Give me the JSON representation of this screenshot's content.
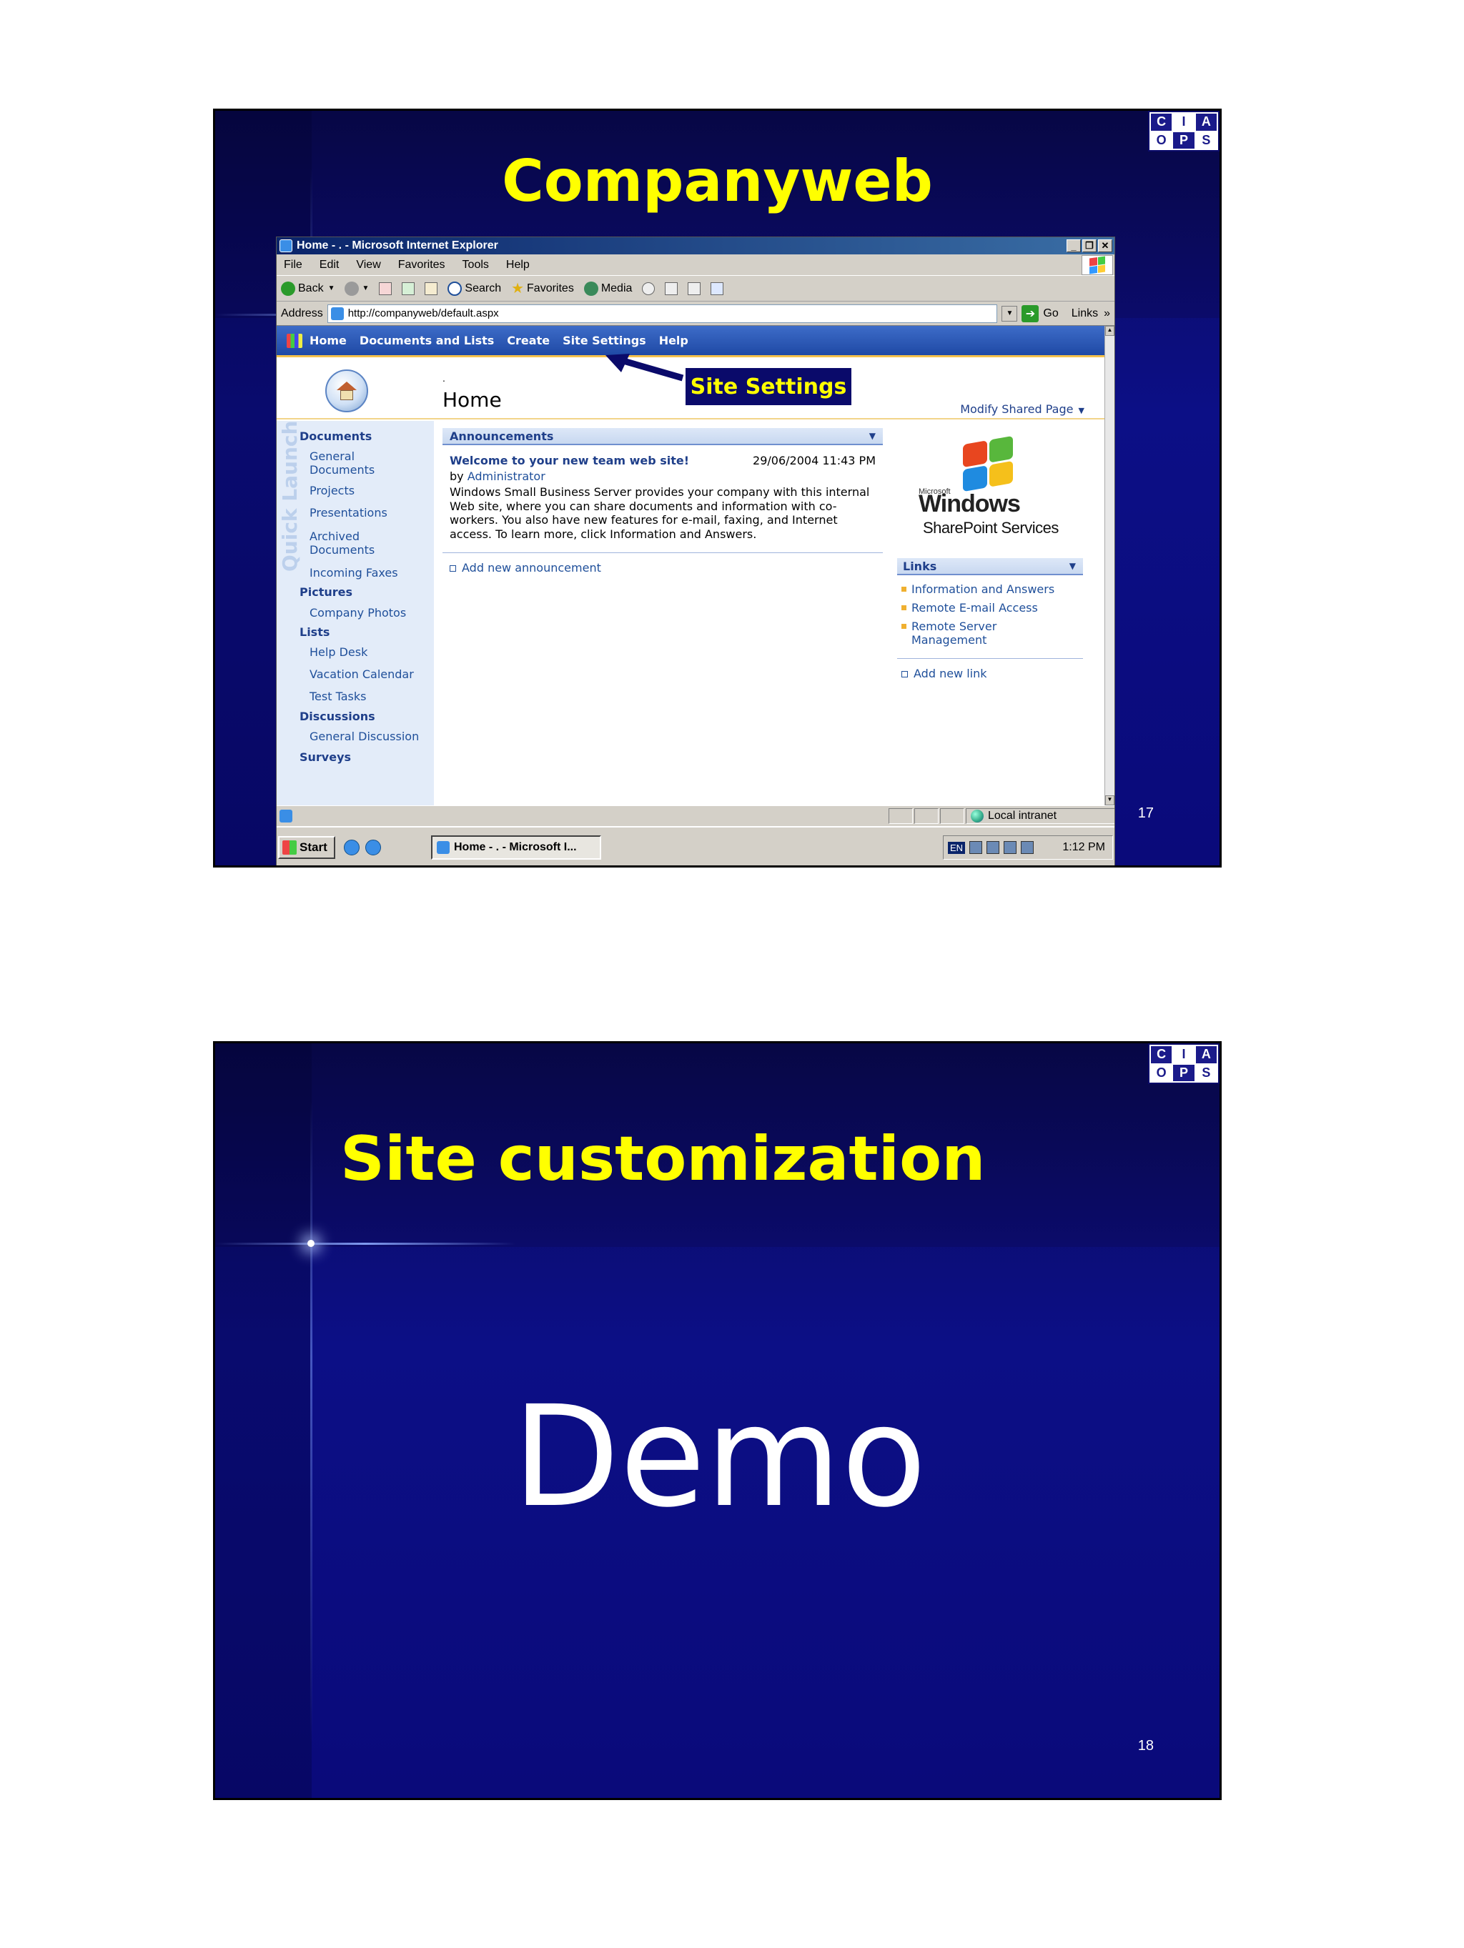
{
  "slide1": {
    "title": "Companyweb",
    "number": "17",
    "logo": [
      "C",
      "I",
      "A",
      "O",
      "P",
      "S"
    ],
    "browser": {
      "window_title": "Home - . - Microsoft Internet Explorer",
      "menu": [
        "File",
        "Edit",
        "View",
        "Favorites",
        "Tools",
        "Help"
      ],
      "toolbar": {
        "back": "Back",
        "search": "Search",
        "favorites": "Favorites",
        "media": "Media"
      },
      "address_label": "Address",
      "url": "http://companyweb/default.aspx",
      "go": "Go",
      "links": "Links",
      "links_more": "»",
      "status_zone": "Local intranet"
    },
    "sharepoint": {
      "nav": [
        "Home",
        "Documents and Lists",
        "Create",
        "Site Settings",
        "Help"
      ],
      "page_dot": ".",
      "page_title": "Home",
      "modify": "Modify Shared Page",
      "callout": "Site Settings",
      "quick_launch_label": "Quick Launch",
      "quick_launch": {
        "documents": "Documents",
        "general_documents": "General Documents",
        "projects": "Projects",
        "presentations": "Presentations",
        "archived_documents": "Archived Documents",
        "incoming_faxes": "Incoming Faxes",
        "pictures": "Pictures",
        "company_photos": "Company Photos",
        "lists": "Lists",
        "help_desk": "Help Desk",
        "vacation_calendar": "Vacation Calendar",
        "test_tasks": "Test Tasks",
        "discussions": "Discussions",
        "general_discussion": "General Discussion",
        "surveys": "Surveys"
      },
      "announcements": {
        "header": "Announcements",
        "title": "Welcome to your new team web site!",
        "date": "29/06/2004 11:43 PM",
        "by_prefix": "by",
        "author": "Administrator",
        "body": "Windows Small Business Server provides your company with this internal Web site, where you can share documents and information with co-workers. You also have new features for e-mail, faxing, and Internet access. To learn more, click Information and Answers.",
        "add": "Add new announcement"
      },
      "logo": {
        "microsoft": "Microsoft",
        "windows": "Windows",
        "sharepoint": "SharePoint Services"
      },
      "links": {
        "header": "Links",
        "items": [
          "Information and Answers",
          "Remote E-mail Access",
          "Remote Server Management"
        ],
        "add": "Add new link"
      }
    },
    "taskbar": {
      "start": "Start",
      "task": "Home - . - Microsoft I...",
      "lang": "EN",
      "clock": "1:12 PM"
    }
  },
  "slide2": {
    "title": "Site customization",
    "body": "Demo",
    "number": "18",
    "logo": [
      "C",
      "I",
      "A",
      "O",
      "P",
      "S"
    ]
  }
}
